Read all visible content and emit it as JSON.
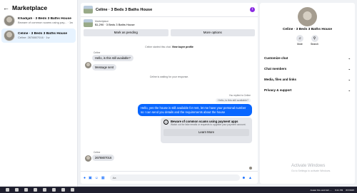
{
  "sidebar": {
    "title": "Marketplace",
    "conversations": [
      {
        "name": "Khadijah · 3 Beds 3 Baths House",
        "preview": "Beware of common scams using pay... · 1w"
      },
      {
        "name": "Celine · 3 Beds 3 Baths House",
        "preview": "Celine: 2678807016 · 1w"
      }
    ]
  },
  "chat": {
    "title": "Celine · 3 Beds 3 Baths House",
    "listing_label": "Marketplace",
    "listing_price": "$1,290 · 3 Beds 3 Baths House",
    "mark_pending": "Mark as pending",
    "more_options": "More options",
    "system_started": "Celine started this chat.",
    "view_profile": "View buyer profile",
    "sender1": "Celine",
    "msg_in_1": "Hello, is this still available?",
    "msg_in_2": "Message sent",
    "system_waiting": "Celine is waiting for your response.",
    "replied_to": "You replied to Celine",
    "quoted": "Hello, is this still available?",
    "msg_out": "Hello, yes the house is still available for rent, let me have your personal number so I can send you details and the requirements about the house",
    "scam_title": "Beware of common scams using payment apps",
    "scam_sub": "Watch out for fake emails or requests to upgrade your payment account.",
    "learn_more": "Learn More",
    "sender2": "Celine",
    "msg_in_3": "2678807016",
    "composer_placeholder": "Aa"
  },
  "details": {
    "name": "Celine · 3 Beds 3 Baths House",
    "mute": "Mute",
    "search": "Search",
    "menu": [
      "Customize chat",
      "Chat members",
      "Media, files and links",
      "Privacy & support"
    ]
  },
  "watermark": {
    "title": "Activate Windows",
    "sub": "Go to Settings to activate Windows."
  },
  "taskbar": {
    "app": "Avatar Fire and Ash -...",
    "time": "9:21 PM",
    "date": "8/7/2025"
  }
}
